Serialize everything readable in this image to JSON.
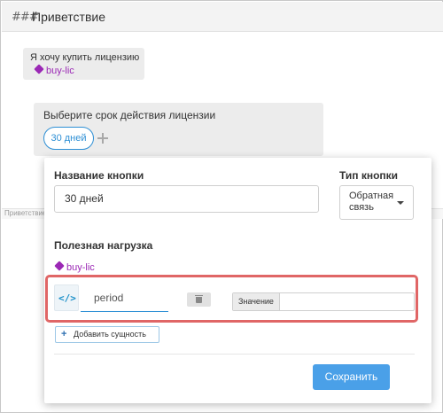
{
  "header": {
    "title": "Приветствие",
    "icon": "hash-icon"
  },
  "flow": {
    "user_message": {
      "text": "Я хочу купить лицензию",
      "tag": "buy-lic"
    },
    "bot_message": {
      "text": "Выберите срок действия лицензии",
      "button_pill": "30 дней"
    },
    "divider_label": "Приветствие"
  },
  "popup": {
    "button_name_label": "Название кнопки",
    "button_name_value": "30 дней",
    "button_type_label": "Тип кнопки",
    "button_type_value": "Обратная связь",
    "payload_label": "Полезная нагрузка",
    "payload_tag": "buy-lic",
    "entity_value": "period",
    "value_addon": "Значение",
    "value_input": "",
    "add_entity_label": "Добавить сущность",
    "save_label": "Сохранить"
  },
  "colors": {
    "accent": "#2d8fd5",
    "tag": "#9b28b5",
    "highlight": "#e06666",
    "save": "#4aa0e8"
  }
}
